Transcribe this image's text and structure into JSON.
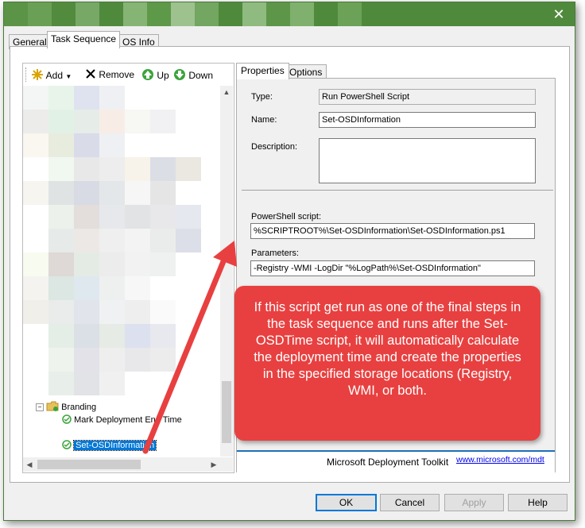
{
  "window": {
    "close_glyph": "✕",
    "title_mosaic": [
      "#5b9446",
      "#6aa055",
      "#528b3e",
      "#77a865",
      "#4f8a3c",
      "#86b474",
      "#5e9849",
      "#9dc28e",
      "#73a661",
      "#4f8a3c",
      "#8fba80",
      "#5d9648",
      "#7fb06d",
      "#4f8a3c",
      "#6ca257"
    ]
  },
  "tabs": [
    {
      "label": "General"
    },
    {
      "label": "Task Sequence"
    },
    {
      "label": "OS Info"
    }
  ],
  "toolbar": {
    "add": "Add",
    "remove": "Remove",
    "up": "Up",
    "down": "Down"
  },
  "tree": {
    "group": "Branding",
    "items": [
      {
        "label": "Mark Deployment End Time"
      },
      {
        "label": "Set-OSDInformation"
      }
    ],
    "mosaic": [
      [
        "#f3f6f4",
        "#e8f4ea",
        "#dfe3ef",
        "#eef0f3",
        "#ffffff",
        "#ffffff",
        "#ffffff"
      ],
      [
        "#ececea",
        "#e2f1e6",
        "#e6ece8",
        "#f7ede6",
        "#f7f7f3",
        "#f1f1f3",
        "#ffffff"
      ],
      [
        "#faf6f0",
        "#e8ecdf",
        "#d9dbe9",
        "#eef0f3",
        "#ffffff",
        "#ffffff",
        "#ffffff"
      ],
      [
        "#ffffff",
        "#f1f8ef",
        "#e8e8e8",
        "#ededed",
        "#f7f3ea",
        "#dcdee6",
        "#ebe7e1"
      ],
      [
        "#f7f5f0",
        "#dfe3e4",
        "#d8dbe3",
        "#e4e7ea",
        "#f6f6f6",
        "#e5e5e5",
        "#ffffff"
      ],
      [
        "#ffffff",
        "#ecf1ec",
        "#e3dedb",
        "#e6e8ec",
        "#e2e3e5",
        "#e8e8ea",
        "#e6e8ef"
      ],
      [
        "#ffffff",
        "#e6eae8",
        "#ebe8e6",
        "#efefef",
        "#f3f3f3",
        "#e9ecea",
        "#dcdfe8"
      ],
      [
        "#f7fbf0",
        "#ded8d6",
        "#e4ebe4",
        "#ececec",
        "#f2f2f2",
        "#eef1ef",
        "#ffffff"
      ],
      [
        "#f5f3f0",
        "#dce6e3",
        "#dfe8ee",
        "#eef0f0",
        "#f7f7f7",
        "#ffffff",
        "#ffffff"
      ],
      [
        "#f1efea",
        "#e9ecea",
        "#e1e4ea",
        "#eff1f3",
        "#eeeeee",
        "#fafafa",
        "#ffffff"
      ],
      [
        "#ffffff",
        "#e4eee6",
        "#dbe0e6",
        "#e6ebe6",
        "#dde0ee",
        "#e7e9ee",
        "#ffffff"
      ],
      [
        "#ffffff",
        "#eef3ee",
        "#e2e2e8",
        "#eeeeee",
        "#e8e8ea",
        "#ececec",
        "#ffffff"
      ],
      [
        "#ffffff",
        "#e8eeea",
        "#e2e3e6",
        "#f0f0f0",
        "#ffffff",
        "#ffffff",
        "#ffffff"
      ]
    ]
  },
  "right_tabs": [
    {
      "label": "Properties"
    },
    {
      "label": "Options"
    }
  ],
  "props": {
    "type_label": "Type:",
    "type_value": "Run PowerShell Script",
    "name_label": "Name:",
    "name_value": "Set-OSDInformation",
    "desc_label": "Description:",
    "desc_value": "",
    "script_label": "PowerShell script:",
    "script_value": "%SCRIPTROOT%\\Set-OSDInformation\\Set-OSDInformation.ps1",
    "params_label": "Parameters:",
    "params_value": "-Registry -WMI -LogDir \"%LogPath%\\Set-OSDInformation\""
  },
  "footer": {
    "brand": "Microsoft Deployment Toolkit",
    "link": "www.microsoft.com/mdt"
  },
  "buttons": {
    "ok": "OK",
    "cancel": "Cancel",
    "apply": "Apply",
    "help": "Help"
  },
  "callout": {
    "text": "If this script get run as one of the final steps in the task sequence and runs after the Set-OSDTime script, it will automatically calculate the deployment time and create the properties in the specified storage locations (Registry, WMI, or both."
  },
  "colors": {
    "title_green": "#4f8a3c",
    "callout_red": "#e84040",
    "selection_blue": "#0078d7"
  },
  "icons": [
    "close-icon",
    "add-star-icon",
    "remove-x-icon",
    "up-arrow-icon",
    "down-arrow-icon",
    "folder-icon",
    "check-icon"
  ]
}
